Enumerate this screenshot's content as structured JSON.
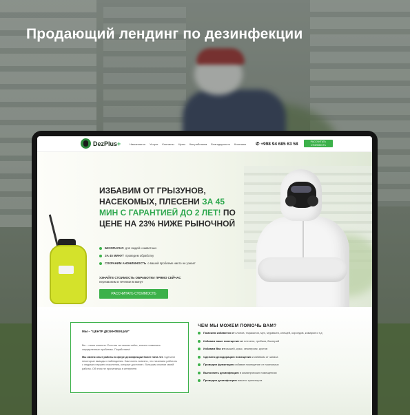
{
  "headline": "Продающий лендинг по дезинфекции",
  "site": {
    "logo_text": "DezPlus",
    "logo_plus": "+",
    "menu": [
      "Нашаплагон",
      "Услуги",
      "Контакты",
      "Цены",
      "Как работаем",
      "Благодарность",
      "Контакты"
    ],
    "phone": "+998 94 685 63 58",
    "nav_button": "РАССЧИТАТЬ СТОИМОСТЬ"
  },
  "hero": {
    "title_part1": "ИЗБАВИМ ОТ ГРЫЗУНОВ, НАСЕКОМЫХ, ПЛЕСЕНИ ",
    "title_green": "ЗА 45 МИН С ГАРАНТИЕЙ ДО 2 ЛЕТ!",
    "title_part2": " ПО ЦЕНЕ НА 23% НИЖЕ РЫНОЧНОЙ",
    "bullets": [
      {
        "bold": "БЕЗОПАСНО",
        "text": "для людей и животных"
      },
      {
        "bold": "ЗА 45 МИНУТ",
        "text": "проведем обработку"
      },
      {
        "bold": "СОХРАНИМ АНОНИМНОСТЬ",
        "text": "о вашей проблеме никто не узнает"
      }
    ],
    "cta_text": "УЗНАЙТЕ СТОИМОСТЬ ОБРАБОТКИ ПРЯМО СЕЙЧАС",
    "cta_sub": "перезвоним в течении 5 минут",
    "cta_button": "РАССЧИТАТЬ СТОИМОСТЬ"
  },
  "about": {
    "title": "МЫ – \"ЦЕНТР ДЕЗИНФЕКЦИИ\"",
    "p1": "Вы – наши клиенты. Если вы на нашем сайте, значит появились определенные проблемы. Поработаем!",
    "p2_bold": "Мы имеем опыт работы в сфере дезинфекции более пяти лет.",
    "p2": " Сделали некоторые выводы и наблюдения. Нам очень повезло, что начинали работать с людьми старшего поколения, которые достигли», большим опытом своей работы. Об этом не прочитаешь в интернете."
  },
  "help": {
    "title": "ЧЕМ МЫ МОЖЕМ ПОМОЧЬ ВАМ?",
    "items": [
      {
        "bold": "Поможем избавится от",
        "text": " клопов, тараканов, мух, муравьев, клещей, короедов, комаров и т.д"
      },
      {
        "bold": "Избавим ваше помещение от",
        "text": " плесени, грибков, бактерий"
      },
      {
        "bold": "Избавим Вас от",
        "text": " мышей, крыс, землероек, кротов"
      },
      {
        "bold": "Сделаем дезодорацию помещения",
        "text": " и избавим от запаха"
      },
      {
        "bold": "Проведем фумигацию",
        "text": " избавив помещение от насекомых"
      },
      {
        "bold": "Выполнить дезинфекцию",
        "text": " в коммерческих помещениях"
      },
      {
        "bold": "Проведем дезинфекцию",
        "text": " вашего транспорта"
      }
    ]
  },
  "colors": {
    "accent": "#3cb14a",
    "dark": "#141414"
  }
}
